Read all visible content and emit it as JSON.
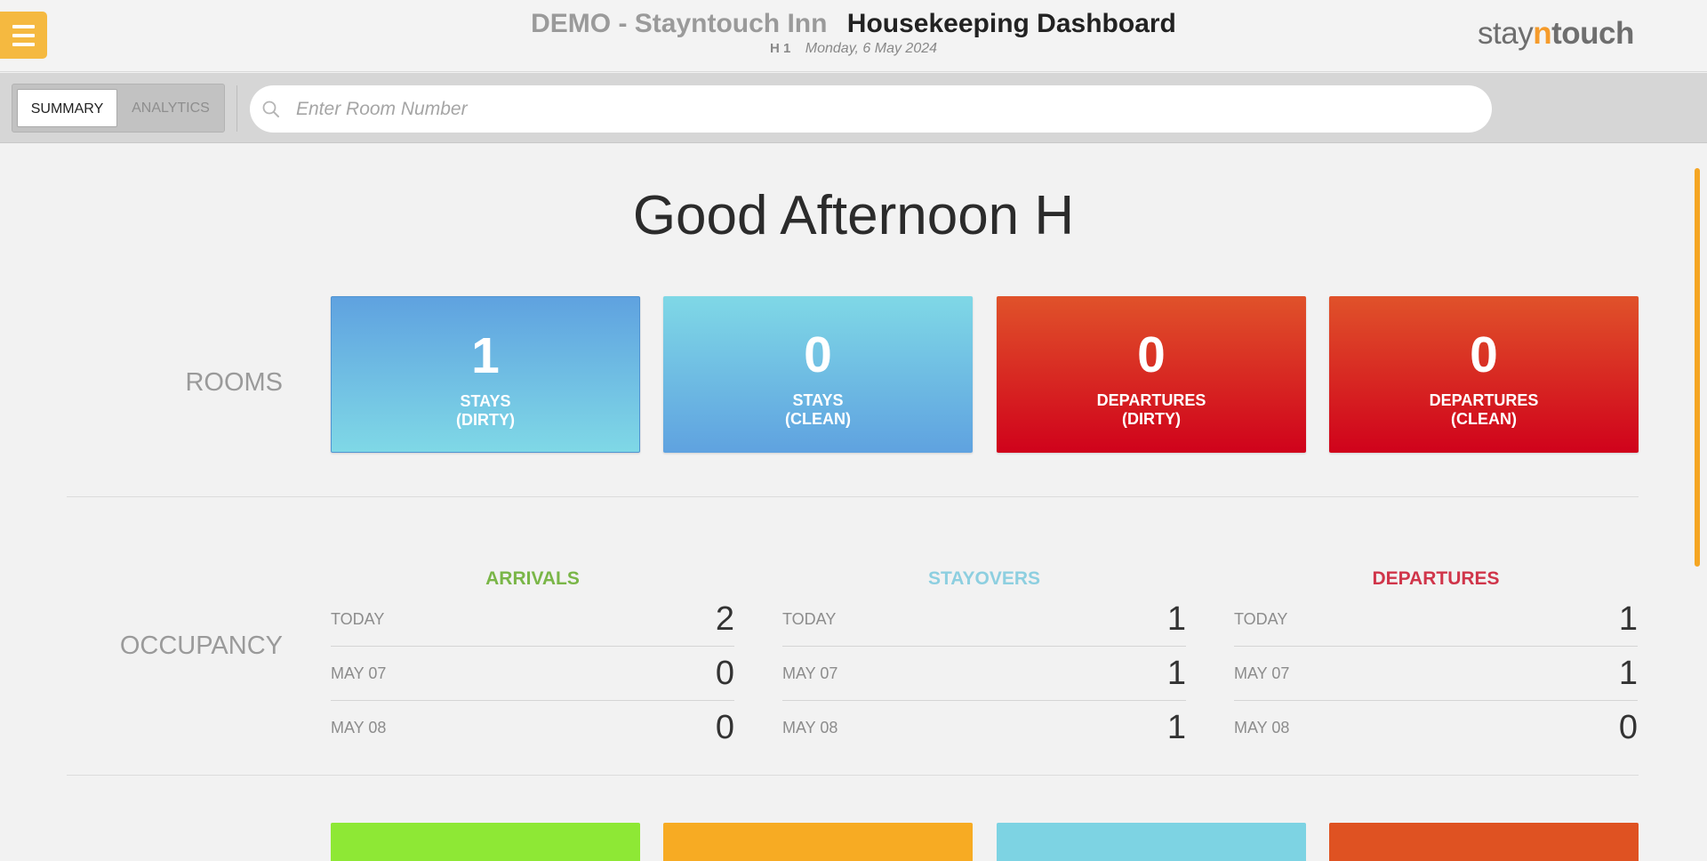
{
  "header": {
    "hotel_name": "DEMO - Stayntouch Inn",
    "page_title": "Housekeeping Dashboard",
    "user": "H 1",
    "date": "Monday, 6 May 2024",
    "logo": {
      "stay": "stay",
      "n": "n",
      "touch": "touch"
    }
  },
  "toolbar": {
    "tabs": [
      {
        "label": "SUMMARY",
        "active": true
      },
      {
        "label": "ANALYTICS",
        "active": false
      }
    ],
    "search": {
      "placeholder": "Enter Room Number",
      "value": ""
    }
  },
  "greeting": "Good Afternoon H",
  "rooms": {
    "label": "ROOMS",
    "tiles": [
      {
        "count": "1",
        "label": "STAYS\n(DIRTY)",
        "color": "#5fa2e0"
      },
      {
        "count": "0",
        "label": "STAYS\n(CLEAN)",
        "color": "#7fd8e6"
      },
      {
        "count": "0",
        "label": "DEPARTURES\n(DIRTY)",
        "color": "#d0021b"
      },
      {
        "count": "0",
        "label": "DEPARTURES\n(CLEAN)",
        "color": "#d0021b"
      }
    ]
  },
  "occupancy": {
    "label": "OCCUPANCY",
    "columns": [
      {
        "title": "ARRIVALS",
        "color": "#7ab648",
        "rows": [
          {
            "date": "TODAY",
            "value": "2"
          },
          {
            "date": "MAY 07",
            "value": "0"
          },
          {
            "date": "MAY 08",
            "value": "0"
          }
        ]
      },
      {
        "title": "STAYOVERS",
        "color": "#8dcfe0",
        "rows": [
          {
            "date": "TODAY",
            "value": "1"
          },
          {
            "date": "MAY 07",
            "value": "1"
          },
          {
            "date": "MAY 08",
            "value": "1"
          }
        ]
      },
      {
        "title": "DEPARTURES",
        "color": "#d0354a",
        "rows": [
          {
            "date": "TODAY",
            "value": "1"
          },
          {
            "date": "MAY 07",
            "value": "1"
          },
          {
            "date": "MAY 08",
            "value": "0"
          }
        ]
      }
    ]
  },
  "bottom_tiles": [
    {
      "color": "#8ee835"
    },
    {
      "color": "#f7ab23"
    },
    {
      "color": "#7dd3e3"
    },
    {
      "color": "#df5222"
    }
  ],
  "colors": {
    "menu_button": "#f5b940",
    "logo_accent": "#f59b2b",
    "scrollbar": "#f5a623"
  }
}
